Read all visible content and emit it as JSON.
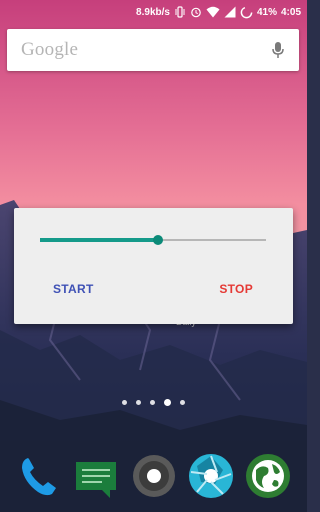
{
  "status_bar": {
    "network_speed": "8.9kb/s",
    "battery": "41%",
    "time": "4:05"
  },
  "search": {
    "logo_text": "Google"
  },
  "dialog": {
    "progress_fraction": 0.52,
    "start_label": "START",
    "stop_label": "STOP"
  },
  "behind_label": "Daily",
  "home": {
    "page_count": 5,
    "active_page": 4
  },
  "dock": {
    "apps": [
      "phone-icon",
      "hangouts-icon",
      "camera-icon",
      "aperture-icon",
      "browser-globe-icon"
    ]
  },
  "colors": {
    "slider_accent": "#149a8a",
    "start_button": "#3f51b5",
    "stop_button": "#e53935"
  }
}
